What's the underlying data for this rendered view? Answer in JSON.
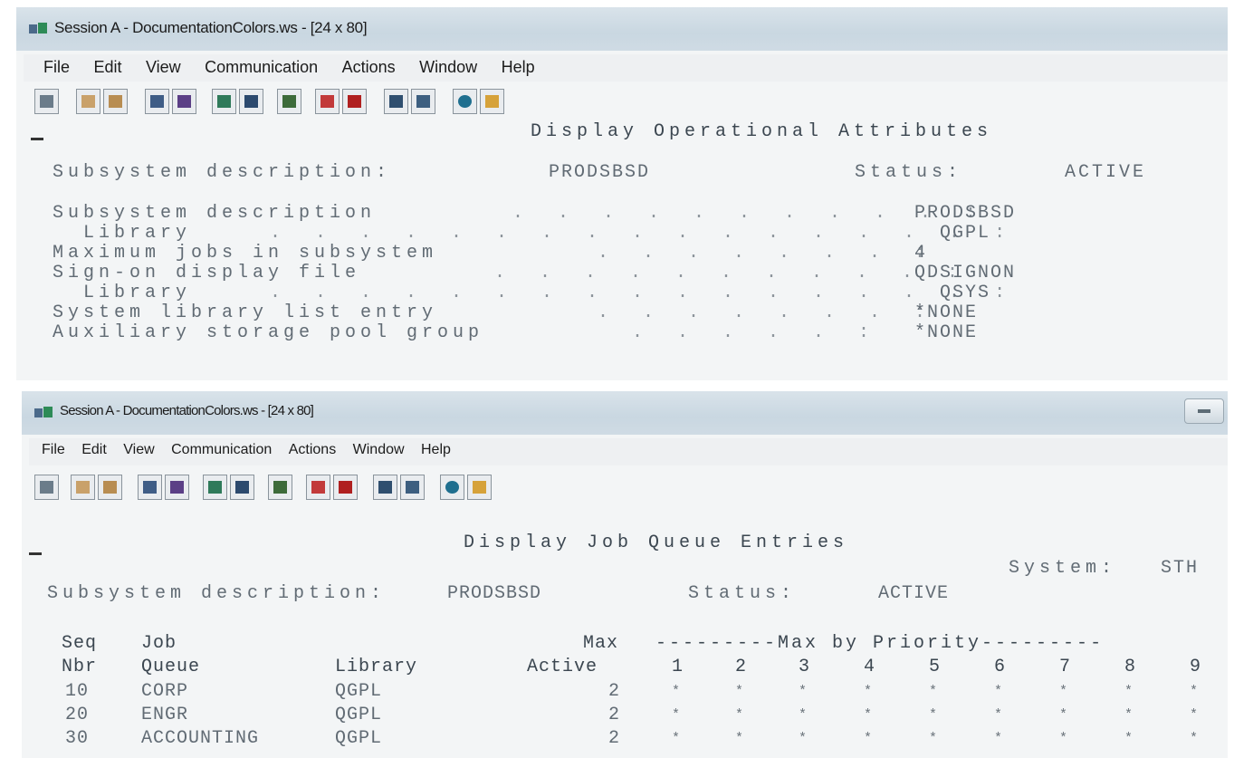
{
  "window_a": {
    "title": "Session A - DocumentationColors.ws - [24 x 80]",
    "menu": [
      "File",
      "Edit",
      "View",
      "Communication",
      "Actions",
      "Window",
      "Help"
    ],
    "screen": {
      "heading": "Display Operational Attributes",
      "subsystem_label": "Subsystem description:",
      "subsystem_value": "PRODSBSD",
      "status_label": "Status:",
      "status_value": "ACTIVE",
      "rows": [
        {
          "label": "Subsystem description",
          "value": "PRODSBSD"
        },
        {
          "label": "  Library",
          "value": "  QGPL"
        },
        {
          "label": "Maximum jobs in subsystem",
          "value": "4"
        },
        {
          "label": "Sign-on display file",
          "value": "QDSIGNON"
        },
        {
          "label": "  Library",
          "value": "  QSYS"
        },
        {
          "label": "System library list entry",
          "value": "*NONE"
        },
        {
          "label": "Auxiliary storage pool group",
          "value": "*NONE"
        }
      ]
    }
  },
  "window_b": {
    "title": "Session A - DocumentationColors.ws - [24 x 80]",
    "menu": [
      "File",
      "Edit",
      "View",
      "Communication",
      "Actions",
      "Window",
      "Help"
    ],
    "screen": {
      "heading": "Display Job Queue Entries",
      "system_label": "System:",
      "system_value": "STH",
      "subsystem_label": "Subsystem description:",
      "subsystem_value": "PRODSBSD",
      "status_label": "Status:",
      "status_value": "ACTIVE",
      "columns": {
        "seq_1": "Seq",
        "seq_2": "Nbr",
        "job_1": "Job",
        "job_2": "Queue",
        "library": "Library",
        "max_1": "Max",
        "max_2": "Active",
        "priority_header": "---------Max by Priority---------",
        "priorities": [
          "1",
          "2",
          "3",
          "4",
          "5",
          "6",
          "7",
          "8",
          "9"
        ]
      },
      "entries": [
        {
          "seq": "10",
          "queue": "CORP",
          "library": "QGPL",
          "max_active": "2",
          "marks": [
            "*",
            "*",
            "*",
            "*",
            "*",
            "*",
            "*",
            "*",
            "*"
          ]
        },
        {
          "seq": "20",
          "queue": "ENGR",
          "library": "QGPL",
          "max_active": "2",
          "marks": [
            "*",
            "*",
            "*",
            "*",
            "*",
            "*",
            "*",
            "*",
            "*"
          ]
        },
        {
          "seq": "30",
          "queue": "ACCOUNTING",
          "library": "QGPL",
          "max_active": "2",
          "marks": [
            "*",
            "*",
            "*",
            "*",
            "*",
            "*",
            "*",
            "*",
            "*"
          ]
        }
      ]
    }
  },
  "toolbar_icons": [
    "print-screen-icon",
    "copy-icon",
    "paste-icon",
    "send-icon",
    "receive-icon",
    "display-icon",
    "keyboard-icon",
    "chart-icon",
    "record-macro-icon",
    "stop-macro-icon",
    "play-macro-icon",
    "macro-list-icon",
    "globe-icon",
    "edit-icon"
  ]
}
